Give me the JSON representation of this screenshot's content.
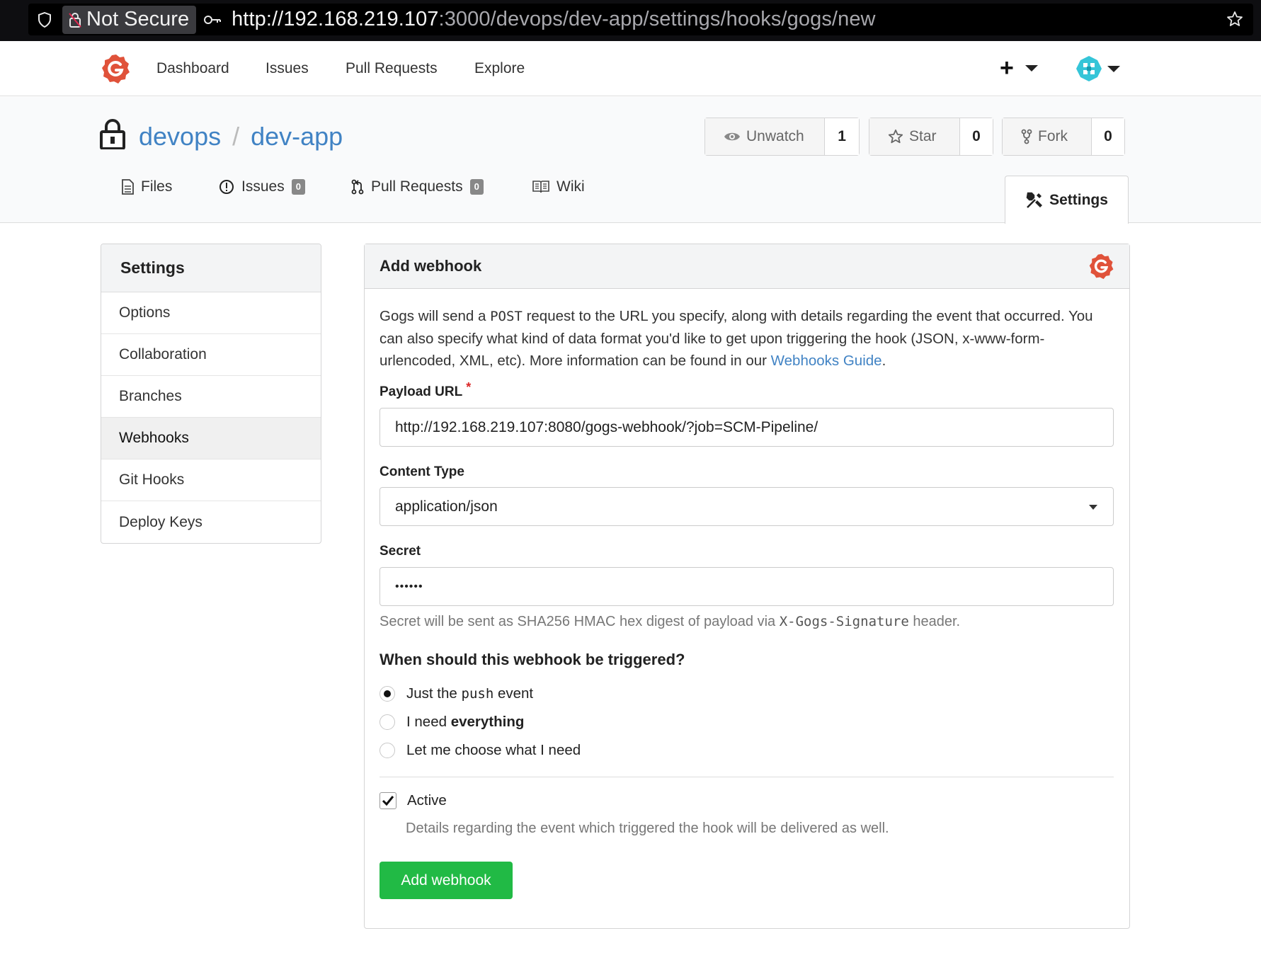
{
  "browser": {
    "security_label": "Not Secure",
    "url_host": "http://192.168.219.107",
    "url_rest": ":3000/devops/dev-app/settings/hooks/gogs/new"
  },
  "topnav": {
    "items": [
      "Dashboard",
      "Issues",
      "Pull Requests",
      "Explore"
    ],
    "plus": "+"
  },
  "repo": {
    "owner": "devops",
    "separator": "/",
    "name": "dev-app",
    "watch_label": "Unwatch",
    "watch_count": "1",
    "star_label": "Star",
    "star_count": "0",
    "fork_label": "Fork",
    "fork_count": "0"
  },
  "tabs": {
    "files": "Files",
    "issues": "Issues",
    "issues_count": "0",
    "pulls": "Pull Requests",
    "pulls_count": "0",
    "wiki": "Wiki",
    "settings": "Settings"
  },
  "sidebar": {
    "title": "Settings",
    "items": [
      "Options",
      "Collaboration",
      "Branches",
      "Webhooks",
      "Git Hooks",
      "Deploy Keys"
    ],
    "active": "Webhooks"
  },
  "form": {
    "title": "Add webhook",
    "desc_1": "Gogs will send a ",
    "desc_code": "POST",
    "desc_2": " request to the URL you specify, along with details regarding the event that occurred. You can also specify what kind of data format you'd like to get upon triggering the hook (JSON, x-www-form-urlencoded, XML, etc). More information can be found in our ",
    "desc_link": "Webhooks Guide",
    "desc_end": ".",
    "payload_label": "Payload URL",
    "required_mark": "*",
    "payload_value": "http://192.168.219.107:8080/gogs-webhook/?job=SCM-Pipeline/",
    "content_type_label": "Content Type",
    "content_type_value": "application/json",
    "secret_label": "Secret",
    "secret_value": "••••••",
    "secret_help_1": "Secret will be sent as SHA256 HMAC hex digest of payload via ",
    "secret_help_code": "X-Gogs-Signature",
    "secret_help_2": " header.",
    "trigger_title": "When should this webhook be triggered?",
    "radio_push_1": "Just the ",
    "radio_push_code": "push",
    "radio_push_2": " event",
    "radio_everything_1": "I need ",
    "radio_everything_bold": "everything",
    "radio_choose": "Let me choose what I need",
    "selected_trigger": "push",
    "active_label": "Active",
    "active_checked": true,
    "active_help": "Details regarding the event which triggered the hook will be delivered as well.",
    "submit_label": "Add webhook"
  },
  "colors": {
    "link": "#4183c4",
    "submit": "#21ba45",
    "gogs_logo": "#e0523a"
  }
}
